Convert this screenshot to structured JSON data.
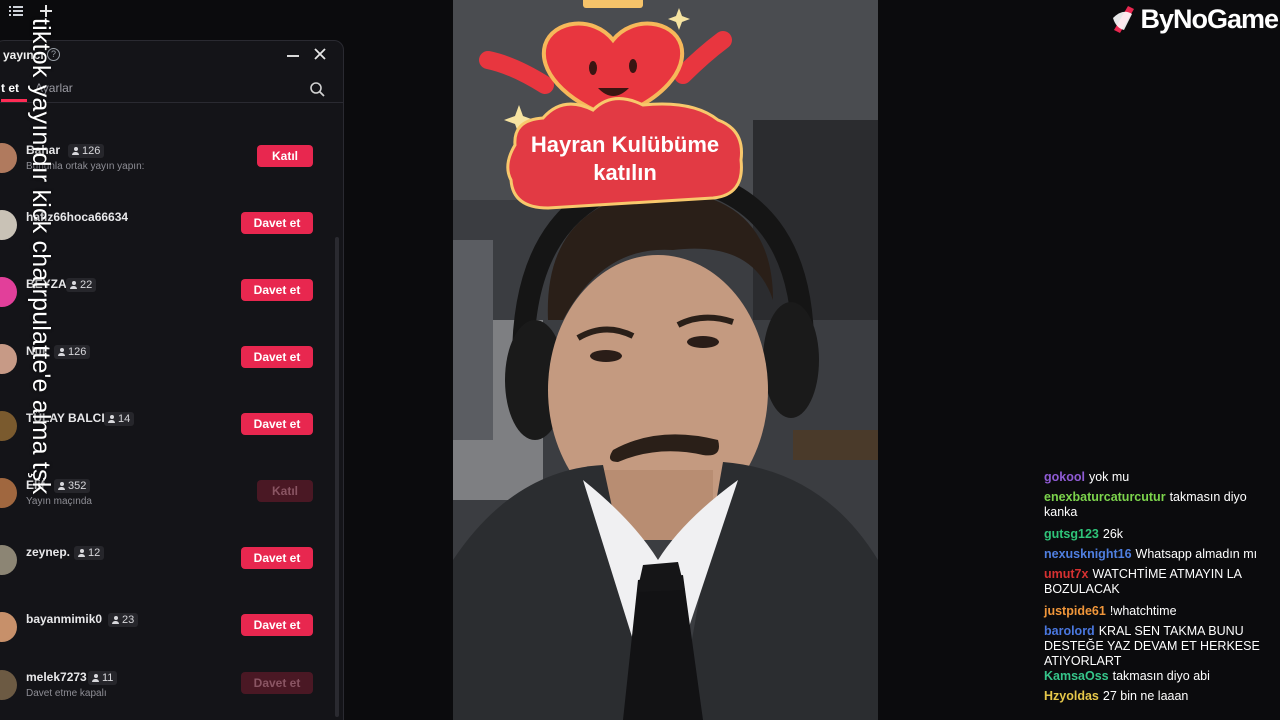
{
  "toolbar": {
    "list_icon": "list-icon",
    "add_icon": "plus-icon"
  },
  "panel": {
    "title": "yayıncı",
    "tabs": [
      {
        "label": "Davet et",
        "visible_label": "t et"
      },
      {
        "label": "Ayarlar",
        "visible_label": "Ayarlar"
      }
    ],
    "rows": [
      {
        "name": "Bahar",
        "viewers": "126",
        "sub": "Bununla ortak yayın yapın:",
        "action": "Katıl",
        "style": "narrow",
        "avatar_color": "#b07a5e"
      },
      {
        "name": "hafız66hoca66634",
        "viewers": "",
        "sub": "",
        "action": "Davet et",
        "style": "wide",
        "avatar_color": "#c9c2b6"
      },
      {
        "name": "BEYZA",
        "viewers": "22",
        "sub": "",
        "action": "Davet et",
        "style": "wide",
        "avatar_color": "#e23f9a"
      },
      {
        "name": "Nur",
        "viewers": "126",
        "sub": "",
        "action": "Davet et",
        "style": "wide",
        "avatar_color": "#c79a86"
      },
      {
        "name": "TÜLAY BALCI",
        "viewers": "14",
        "sub": "",
        "action": "Davet et",
        "style": "wide",
        "avatar_color": "#7a5a2e"
      },
      {
        "name": "Elif",
        "viewers": "352",
        "sub": "Yayın maçında",
        "action": "Katıl",
        "style": "narrow-disabled",
        "avatar_color": "#a0673f"
      },
      {
        "name": "zeynep.",
        "viewers": "12",
        "sub": "",
        "action": "Davet et",
        "style": "wide",
        "avatar_color": "#8c8574"
      },
      {
        "name": "bayanmimik0",
        "viewers": "23",
        "sub": "",
        "action": "Davet et",
        "style": "wide",
        "avatar_color": "#c7906a"
      },
      {
        "name": "melek7273",
        "viewers": "11",
        "sub": "Davet etme kapalı",
        "action": "Davet et",
        "style": "wide-disabled",
        "avatar_color": "#6c5a43"
      }
    ]
  },
  "overlay": {
    "text": "tiktok yayınıdır kick chatrpulatte'e alma tşk"
  },
  "camera": {
    "banner_text_line1": "Hayran Kulübüme",
    "banner_text_line2": "katılın",
    "colors": {
      "heart": "#e8363f",
      "banner": "#e23a44"
    }
  },
  "brand": {
    "logo_text": "ByNoGame",
    "accent": "#e8274f"
  },
  "chat": {
    "messages": [
      {
        "user": "gokool",
        "text": "yok mu",
        "color": "#8f5bd4"
      },
      {
        "user": "enexbaturcaturcutur",
        "text": "takmasın diyo kanka",
        "color": "#7cd44c"
      },
      {
        "user": "gutsg123",
        "text": "26k",
        "color": "#2fc479"
      },
      {
        "user": "nexusknight16",
        "text": "Whatsapp almadın mı",
        "color": "#4f7fe0"
      },
      {
        "user": "umut7x",
        "text": "WATCHTİME ATMAYIN LA BOZULACAK",
        "color": "#d63131"
      },
      {
        "user": "justpide61",
        "text": "!whatchtime",
        "color": "#f0963a"
      },
      {
        "user": "barolord",
        "text": "KRAL SEN TAKMA BUNU DESTEĞE YAZ DEVAM ET HERKESE ATIYORLART",
        "color": "#4a78e0"
      },
      {
        "user": "KamsaOss",
        "text": "takmasın diyo abi",
        "color": "#36c58a"
      },
      {
        "user": "Hzyoldas",
        "text": "27 bin ne laaan",
        "color": "#e6c84a"
      }
    ]
  }
}
